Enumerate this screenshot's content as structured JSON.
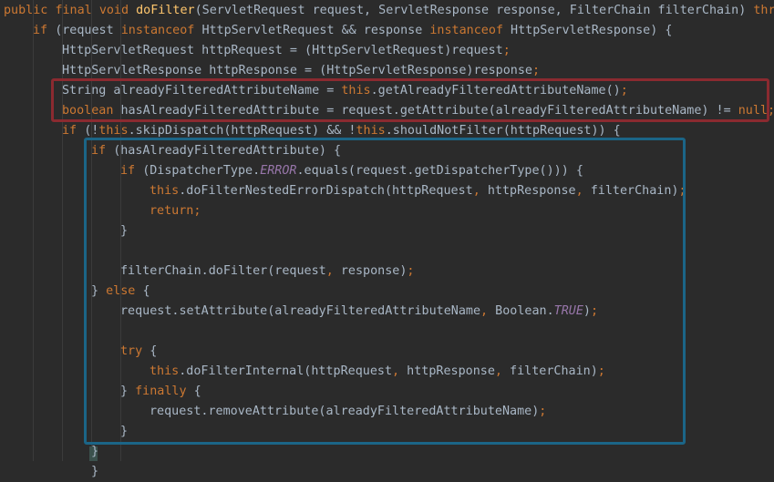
{
  "colors": {
    "background": "#2b2b2b",
    "keyword": "#cc7832",
    "method": "#ffc66d",
    "constant": "#9876aa",
    "text": "#a9b7c6",
    "highlight_red": "#8b2a30",
    "highlight_blue": "#1b6587"
  },
  "code_lines": [
    {
      "indent": 0,
      "tokens": [
        {
          "t": "kw",
          "v": "public "
        },
        {
          "t": "kw",
          "v": "final "
        },
        {
          "t": "kw",
          "v": "void "
        },
        {
          "t": "fn",
          "v": "doFilter"
        },
        {
          "t": "plain",
          "v": "(ServletRequest request, ServletResponse response, FilterChain filterChain) "
        },
        {
          "t": "kw",
          "v": "throws"
        }
      ]
    },
    {
      "indent": 1,
      "tokens": [
        {
          "t": "kw",
          "v": "if "
        },
        {
          "t": "plain",
          "v": "(request "
        },
        {
          "t": "kw",
          "v": "instanceof "
        },
        {
          "t": "plain",
          "v": "HttpServletRequest && response "
        },
        {
          "t": "kw",
          "v": "instanceof "
        },
        {
          "t": "plain",
          "v": "HttpServletResponse) {"
        }
      ]
    },
    {
      "indent": 2,
      "tokens": [
        {
          "t": "plain",
          "v": "HttpServletRequest httpRequest = (HttpServletRequest)request"
        },
        {
          "t": "kw",
          "v": ";"
        }
      ]
    },
    {
      "indent": 2,
      "tokens": [
        {
          "t": "plain",
          "v": "HttpServletResponse httpResponse = (HttpServletResponse)response"
        },
        {
          "t": "kw",
          "v": ";"
        }
      ]
    },
    {
      "indent": 2,
      "tokens": [
        {
          "t": "plain",
          "v": "String alreadyFilteredAttributeName = "
        },
        {
          "t": "kw",
          "v": "this"
        },
        {
          "t": "plain",
          "v": ".getAlreadyFilteredAttributeName()"
        },
        {
          "t": "kw",
          "v": ";"
        }
      ]
    },
    {
      "indent": 2,
      "tokens": [
        {
          "t": "kw",
          "v": "boolean "
        },
        {
          "t": "plain",
          "v": "hasAlreadyFilteredAttribute = request.getAttribute(alreadyFilteredAttributeName) != "
        },
        {
          "t": "kw",
          "v": "null"
        },
        {
          "t": "kw",
          "v": ";"
        }
      ]
    },
    {
      "indent": 2,
      "tokens": [
        {
          "t": "kw",
          "v": "if "
        },
        {
          "t": "plain",
          "v": "(!"
        },
        {
          "t": "kw",
          "v": "this"
        },
        {
          "t": "plain",
          "v": ".skipDispatch(httpRequest) && !"
        },
        {
          "t": "kw",
          "v": "this"
        },
        {
          "t": "plain",
          "v": ".shouldNotFilter(httpRequest)) {"
        }
      ]
    },
    {
      "indent": 3,
      "tokens": [
        {
          "t": "kw",
          "v": "if "
        },
        {
          "t": "plain",
          "v": "(hasAlreadyFilteredAttribute) {"
        }
      ]
    },
    {
      "indent": 4,
      "tokens": [
        {
          "t": "kw",
          "v": "if "
        },
        {
          "t": "plain",
          "v": "(DispatcherType."
        },
        {
          "t": "cst",
          "v": "ERROR"
        },
        {
          "t": "plain",
          "v": ".equals(request.getDispatcherType())) {"
        }
      ]
    },
    {
      "indent": 5,
      "tokens": [
        {
          "t": "kw",
          "v": "this"
        },
        {
          "t": "plain",
          "v": ".doFilterNestedErrorDispatch(httpRequest"
        },
        {
          "t": "kw",
          "v": ", "
        },
        {
          "t": "plain",
          "v": "httpResponse"
        },
        {
          "t": "kw",
          "v": ", "
        },
        {
          "t": "plain",
          "v": "filterChain)"
        },
        {
          "t": "kw",
          "v": ";"
        }
      ]
    },
    {
      "indent": 5,
      "tokens": [
        {
          "t": "kw",
          "v": "return;"
        }
      ]
    },
    {
      "indent": 4,
      "tokens": [
        {
          "t": "plain",
          "v": "}"
        }
      ]
    },
    {
      "indent": 4,
      "tokens": []
    },
    {
      "indent": 4,
      "tokens": [
        {
          "t": "plain",
          "v": "filterChain.doFilter(request"
        },
        {
          "t": "kw",
          "v": ", "
        },
        {
          "t": "plain",
          "v": "response)"
        },
        {
          "t": "kw",
          "v": ";"
        }
      ]
    },
    {
      "indent": 3,
      "tokens": [
        {
          "t": "plain",
          "v": "} "
        },
        {
          "t": "kw",
          "v": "else "
        },
        {
          "t": "plain",
          "v": "{"
        }
      ]
    },
    {
      "indent": 4,
      "tokens": [
        {
          "t": "plain",
          "v": "request.setAttribute(alreadyFilteredAttributeName"
        },
        {
          "t": "kw",
          "v": ", "
        },
        {
          "t": "plain",
          "v": "Boolean."
        },
        {
          "t": "cst",
          "v": "TRUE"
        },
        {
          "t": "plain",
          "v": ")"
        },
        {
          "t": "kw",
          "v": ";"
        }
      ]
    },
    {
      "indent": 4,
      "tokens": []
    },
    {
      "indent": 4,
      "tokens": [
        {
          "t": "kw",
          "v": "try "
        },
        {
          "t": "plain",
          "v": "{"
        }
      ]
    },
    {
      "indent": 5,
      "tokens": [
        {
          "t": "kw",
          "v": "this"
        },
        {
          "t": "plain",
          "v": ".doFilterInternal(httpRequest"
        },
        {
          "t": "kw",
          "v": ", "
        },
        {
          "t": "plain",
          "v": "httpResponse"
        },
        {
          "t": "kw",
          "v": ", "
        },
        {
          "t": "plain",
          "v": "filterChain)"
        },
        {
          "t": "kw",
          "v": ";"
        }
      ]
    },
    {
      "indent": 4,
      "tokens": [
        {
          "t": "plain",
          "v": "} "
        },
        {
          "t": "kw",
          "v": "finally "
        },
        {
          "t": "plain",
          "v": "{"
        }
      ]
    },
    {
      "indent": 5,
      "tokens": [
        {
          "t": "plain",
          "v": "request.removeAttribute(alreadyFilteredAttributeName)"
        },
        {
          "t": "kw",
          "v": ";"
        }
      ]
    },
    {
      "indent": 4,
      "tokens": [
        {
          "t": "plain",
          "v": "}"
        }
      ]
    },
    {
      "indent": 3,
      "tokens": [
        {
          "t": "plain",
          "v": "}"
        }
      ]
    },
    {
      "indent": 3,
      "tokens": [
        {
          "t": "plain",
          "v": "}"
        }
      ]
    }
  ]
}
